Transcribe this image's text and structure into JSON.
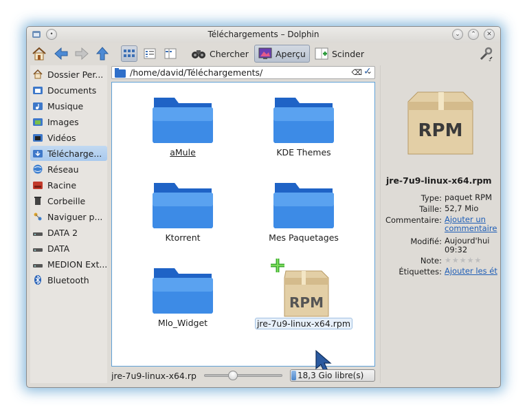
{
  "window": {
    "title": "Téléchargements – Dolphin"
  },
  "toolbar": {
    "search_label": "Chercher",
    "preview_label": "Aperçu",
    "split_label": "Scinder"
  },
  "places": [
    {
      "label": "Dossier Per...",
      "icon": "home-icon"
    },
    {
      "label": "Documents",
      "icon": "documents-folder-icon"
    },
    {
      "label": "Musique",
      "icon": "music-folder-icon"
    },
    {
      "label": "Images",
      "icon": "images-folder-icon"
    },
    {
      "label": "Vidéos",
      "icon": "videos-folder-icon"
    },
    {
      "label": "Télécharge...",
      "icon": "downloads-folder-icon"
    },
    {
      "label": "Réseau",
      "icon": "network-icon"
    },
    {
      "label": "Racine",
      "icon": "root-folder-icon"
    },
    {
      "label": "Corbeille",
      "icon": "trash-icon"
    },
    {
      "label": "Naviguer p...",
      "icon": "browse-network-icon"
    },
    {
      "label": "DATA 2",
      "icon": "drive-icon"
    },
    {
      "label": "DATA",
      "icon": "drive-icon"
    },
    {
      "label": "MEDION Ext...",
      "icon": "drive-icon"
    },
    {
      "label": "Bluetooth",
      "icon": "bluetooth-icon"
    }
  ],
  "location": {
    "path": "/home/david/Téléchargements/"
  },
  "files": [
    {
      "name": "aMule",
      "type": "folder"
    },
    {
      "name": "KDE Themes",
      "type": "folder"
    },
    {
      "name": "Ktorrent",
      "type": "folder"
    },
    {
      "name": "Mes Paquetages",
      "type": "folder"
    },
    {
      "name": "Mlo_Widget",
      "type": "folder"
    },
    {
      "name": "jre-7u9-linux-x64.rpm",
      "type": "rpm"
    }
  ],
  "status": {
    "selected_file": "jre-7u9-linux-x64.rp",
    "free_space": "18,3 Gio libre(s)"
  },
  "info_panel": {
    "file_name": "jre-7u9-linux-x64.rpm",
    "rpm_text": "RPM",
    "type_key": "Type:",
    "type_value": "paquet RPM",
    "size_key": "Taille:",
    "size_value": "52,7 Mio",
    "comment_key": "Commentaire:",
    "comment_link": "Ajouter un commentaire",
    "modified_key": "Modifié:",
    "modified_value": "Aujourd'hui 09:32",
    "rating_key": "Note:",
    "rating_value": "0 of 5",
    "tags_key": "Étiquettes:",
    "tags_link": "Ajouter les ét"
  }
}
